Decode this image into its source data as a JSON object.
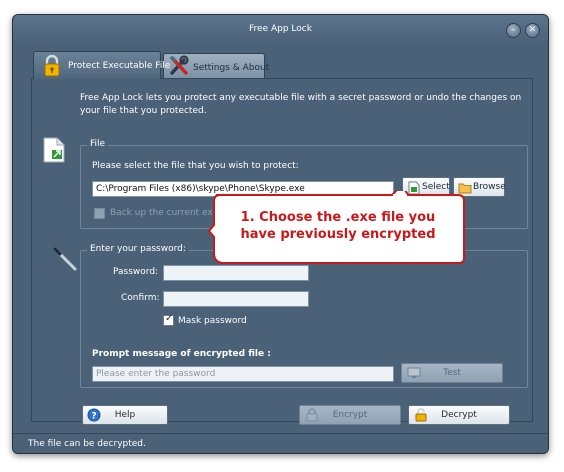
{
  "window": {
    "title": "Free App Lock"
  },
  "titlebar": {
    "minimize_glyph": "–",
    "close_glyph": "✕"
  },
  "tabs": [
    {
      "label": "Protect Executable File",
      "icon": "lock-icon",
      "active": true
    },
    {
      "label": "Settings & About",
      "icon": "tools-icon",
      "active": false
    }
  ],
  "intro": "Free App Lock lets you protect any executable file with a secret password or undo the changes on your file that you protected.",
  "file_group": {
    "title": "File",
    "prompt": "Please select the file that you wish to protect:",
    "path_value": "C:\\Program Files (x86)\\skype\\Phone\\Skype.exe",
    "select_label": "Select",
    "browse_label": "Browse",
    "backup_label": "Back up the current executable file to *.bak",
    "backup_checked": false
  },
  "password_group": {
    "title": "Enter your password:",
    "password_label": "Password:",
    "password_value": "",
    "confirm_label": "Confirm:",
    "confirm_value": "",
    "mask_label": "Mask password",
    "mask_checked": true,
    "prompt_title": "Prompt message of encrypted file :",
    "prompt_placeholder": "Please enter the password",
    "test_label": "Test"
  },
  "actions": {
    "help_label": "Help",
    "encrypt_label": "Encrypt",
    "decrypt_label": "Decrypt"
  },
  "status": {
    "text": "The file can be decrypted."
  },
  "callout": {
    "text": "1. Choose the .exe file you have previously encrypted"
  },
  "colors": {
    "window_bg": "#4a6178",
    "callout_text": "#c8191b",
    "callout_border": "#c8191b"
  }
}
